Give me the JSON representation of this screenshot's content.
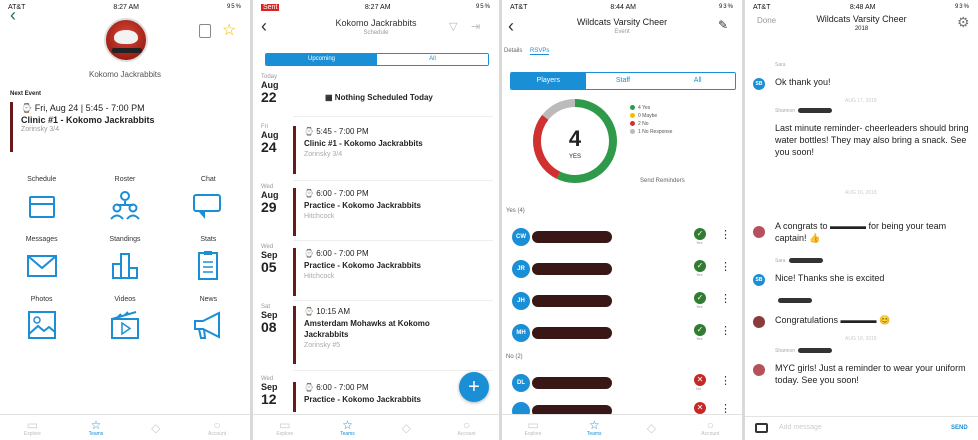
{
  "screen1": {
    "status": {
      "carrier": "AT&T",
      "time": "8:27 AM",
      "battery": "95%"
    },
    "team_name": "Kokomo Jackrabbits",
    "next_event_header": "Next Event",
    "next_event": {
      "date": "Fri, Aug 24 | 5:45 - 7:00 PM",
      "name": "Clinic #1 - Kokomo Jackrabbits",
      "location": "Zorinsky 3/4"
    },
    "grid": [
      {
        "label": "Schedule",
        "icon": "calendar-icon"
      },
      {
        "label": "Roster",
        "icon": "roster-icon"
      },
      {
        "label": "Chat",
        "icon": "chat-icon"
      },
      {
        "label": "Messages",
        "icon": "mail-icon"
      },
      {
        "label": "Standings",
        "icon": "standings-icon"
      },
      {
        "label": "Stats",
        "icon": "clipboard-icon"
      },
      {
        "label": "Photos",
        "icon": "photo-icon"
      },
      {
        "label": "Videos",
        "icon": "video-icon"
      },
      {
        "label": "News",
        "icon": "megaphone-icon"
      }
    ],
    "tabs": [
      "Explore",
      "Teams",
      "",
      "Account"
    ]
  },
  "screen2": {
    "status": {
      "carrier": "Sent",
      "time": "8:27 AM",
      "battery": "95%"
    },
    "title": "Kokomo Jackrabbits",
    "subtitle": "Schedule",
    "segments": [
      "Upcoming",
      "All"
    ],
    "today": {
      "weekday": "Today",
      "month": "Aug",
      "day": "22",
      "text": "Nothing Scheduled Today"
    },
    "events": [
      {
        "weekday": "Fri",
        "month": "Aug",
        "day": "24",
        "time": "5:45 - 7:00 PM",
        "name": "Clinic #1 - Kokomo Jackrabbits",
        "location": "Zorinsky 3/4"
      },
      {
        "weekday": "Wed",
        "month": "Aug",
        "day": "29",
        "time": "6:00 - 7:00 PM",
        "name": "Practice - Kokomo Jackrabbits",
        "location": "Hitchcock"
      },
      {
        "weekday": "Wed",
        "month": "Sep",
        "day": "05",
        "time": "6:00 - 7:00 PM",
        "name": "Practice - Kokomo Jackrabbits",
        "location": "Hitchcock"
      },
      {
        "weekday": "Sat",
        "month": "Sep",
        "day": "08",
        "time": "10:15 AM",
        "name": "Amsterdam Mohawks at Kokomo",
        "name2": "Jackrabbits",
        "location": "Zorinsky #5"
      },
      {
        "weekday": "Wed",
        "month": "Sep",
        "day": "12",
        "time": "6:00 - 7:00 PM",
        "name": "Practice - Kokomo Jackrabbits",
        "location": ""
      }
    ],
    "fab": "+",
    "tabs": [
      "Explore",
      "Teams",
      "",
      "Account"
    ]
  },
  "screen3": {
    "status": {
      "carrier": "AT&T",
      "time": "8:44 AM",
      "battery": "93%"
    },
    "title": "Wildcats Varsity Cheer",
    "subtitle": "Event",
    "tabs_top": [
      "Details",
      "RSVPs"
    ],
    "segments": [
      "Players",
      "Staff",
      "All"
    ],
    "donut": {
      "count": "4",
      "label": "YES"
    },
    "legend": [
      {
        "label": "4 Yes",
        "color": "#2e9a4a",
        "value": 4
      },
      {
        "label": "0 Maybe",
        "color": "#f0c000",
        "value": 0
      },
      {
        "label": "2 No",
        "color": "#d03030",
        "value": 2
      },
      {
        "label": "1 No Response",
        "color": "#bbbbbb",
        "value": 1
      }
    ],
    "send_reminders": "Send Reminders",
    "yes_header": "Yes (4)",
    "yes": [
      {
        "initials": "CW",
        "status": "Yes"
      },
      {
        "initials": "JR",
        "status": "Yes"
      },
      {
        "initials": "JH",
        "status": "Yes"
      },
      {
        "initials": "MH",
        "status": "Yes"
      }
    ],
    "no_header": "No (2)",
    "no": [
      {
        "initials": "DL",
        "status": "No"
      },
      {
        "initials": "",
        "status": ""
      }
    ],
    "tabs": [
      "Explore",
      "Teams",
      "",
      "Account"
    ]
  },
  "screen4": {
    "status": {
      "carrier": "AT&T",
      "time": "8:48 AM",
      "battery": "93%"
    },
    "done": "Done",
    "title": "Wildcats Varsity Cheer",
    "subtitle": "2018",
    "messages": [
      {
        "sender": "Sara",
        "text": "Ok thank you!",
        "time": "AUG 17, 2018",
        "avatar": "SB",
        "color": "#1b8fd6"
      },
      {
        "sender": "Shannon",
        "text": "Last minute reminder- cheerleaders should bring water bottles! They may also bring a snack. See you soon!",
        "time": "AUG 16, 2018",
        "avatar": "",
        "color": ""
      },
      {
        "sender": "",
        "text": "A congrats to ▬▬▬▬ for being your team captain! 👍",
        "time": "",
        "avatar": "",
        "color": "#b5515b"
      },
      {
        "sender": "Sara",
        "text": "Nice! Thanks she is excited",
        "time": "",
        "avatar": "SB",
        "color": "#1b8fd6"
      },
      {
        "sender": "",
        "text": "Congratulations ▬▬▬▬ 😊",
        "time": "AUG 18, 2018",
        "avatar": "",
        "color": "#8b3a3a"
      },
      {
        "sender": "Shannon",
        "text": "MYC girls! Just a reminder to wear your uniform today. See you soon!",
        "time": "",
        "avatar": "",
        "color": "#b5515b"
      }
    ],
    "input_placeholder": "Add message",
    "send": "SEND"
  }
}
